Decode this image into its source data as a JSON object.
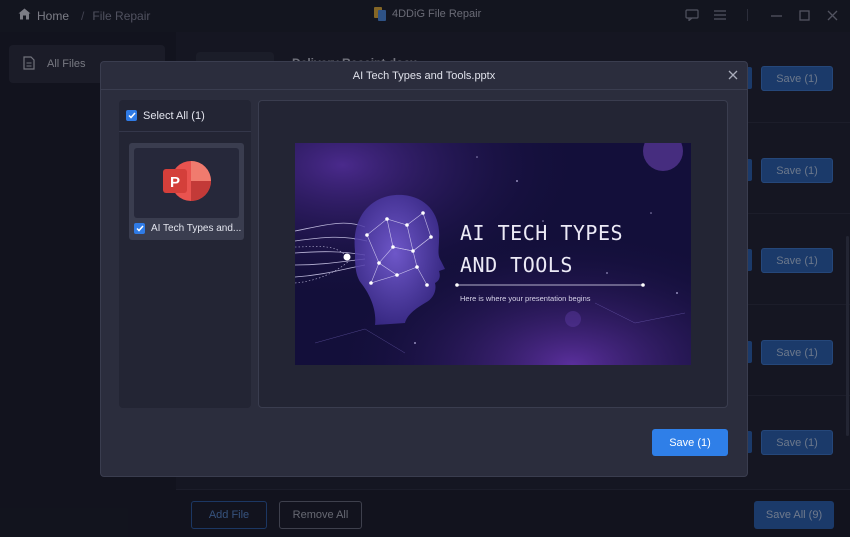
{
  "breadcrumb": {
    "home": "Home",
    "current": "File Repair"
  },
  "app": {
    "title": "4DDiG File Repair"
  },
  "sidebar": {
    "items": [
      {
        "label": "All Files"
      }
    ]
  },
  "background_list": {
    "first_title": "Delivery Receipt.docx",
    "row_save_labels": [
      "Save (1)",
      "Save (1)",
      "Save (1)",
      "Save (1)",
      "Save (1)"
    ]
  },
  "footer": {
    "add_file": "Add File",
    "remove_all": "Remove All",
    "save_all": "Save All (9)"
  },
  "modal": {
    "title": "AI Tech Types and Tools.pptx",
    "select_all": "Select All (1)",
    "file_label": "AI Tech Types and...",
    "save": "Save (1)",
    "slide": {
      "title": "AI TECH TYPES\nAND TOOLS",
      "subtitle": "Here is where your presentation begins"
    }
  },
  "colors": {
    "accent": "#2f7fe8",
    "slide_bg": "#130f3a",
    "ppt_icon": "#e04b4b"
  }
}
